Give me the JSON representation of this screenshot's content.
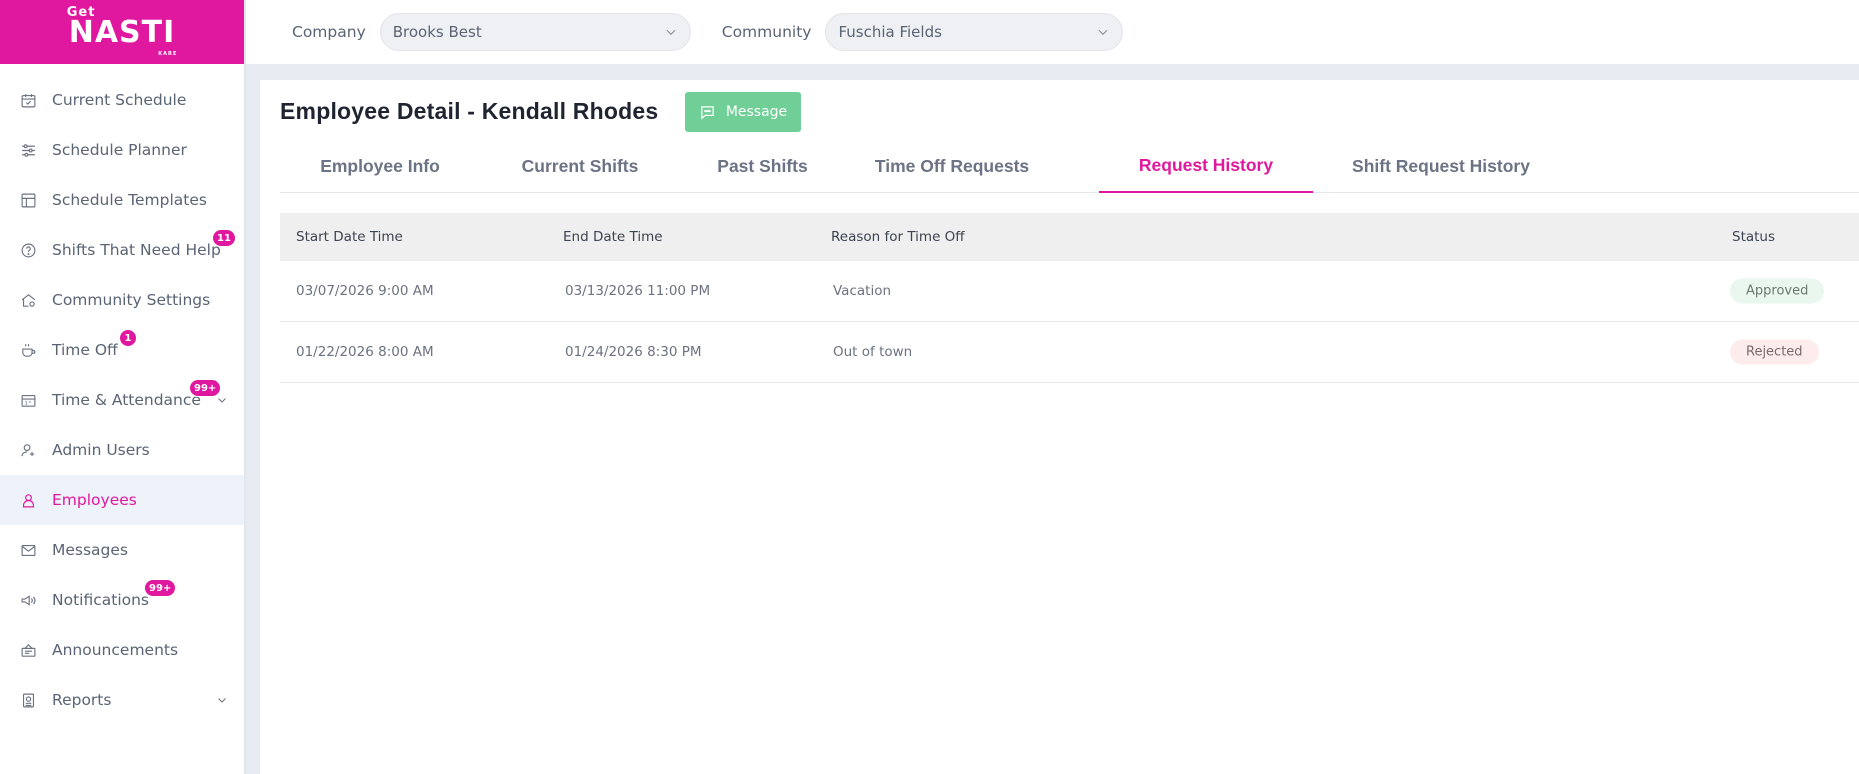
{
  "app": {
    "logo_top": "Get",
    "logo_main": "NASTI",
    "logo_sub": "KARE",
    "brand_color": "#e0189f",
    "success_color": "#6fcf97"
  },
  "sidebar": {
    "items": [
      {
        "label": "Current Schedule",
        "icon": "calendar-check-icon"
      },
      {
        "label": "Schedule Planner",
        "icon": "sliders-icon"
      },
      {
        "label": "Schedule Templates",
        "icon": "layout-icon"
      },
      {
        "label": "Shifts That Need Help",
        "icon": "help-circle-icon",
        "badge": "11"
      },
      {
        "label": "Community Settings",
        "icon": "home-gear-icon"
      },
      {
        "label": "Time Off",
        "icon": "coffee-icon",
        "badge": "1"
      },
      {
        "label": "Time & Attendance",
        "icon": "calendar-grid-icon",
        "badge": "99+"
      },
      {
        "label": "Admin Users",
        "icon": "user-gear-icon"
      },
      {
        "label": "Employees",
        "icon": "user-icon"
      },
      {
        "label": "Messages",
        "icon": "mail-icon"
      },
      {
        "label": "Notifications",
        "icon": "megaphone-icon",
        "badge": "99+"
      },
      {
        "label": "Announcements",
        "icon": "signboard-icon"
      },
      {
        "label": "Reports",
        "icon": "report-icon"
      }
    ]
  },
  "topbar": {
    "company_label": "Company",
    "company_value": "Brooks Best",
    "community_label": "Community",
    "community_value": "Fuschia Fields"
  },
  "main": {
    "title": "Employee Detail - Kendall Rhodes",
    "message_button": "Message",
    "tabs": [
      {
        "label": "Employee Info"
      },
      {
        "label": "Current Shifts"
      },
      {
        "label": "Past Shifts"
      },
      {
        "label": "Time Off Requests"
      },
      {
        "label": "Request History"
      },
      {
        "label": "Shift Request History"
      }
    ],
    "table": {
      "headers": [
        "Start Date Time",
        "End Date Time",
        "Reason for Time Off",
        "Status"
      ],
      "rows": [
        {
          "start": "03/07/2026 9:00 AM",
          "end": "03/13/2026 11:00 PM",
          "reason": "Vacation",
          "status": "Approved"
        },
        {
          "start": "01/22/2026 8:00 AM",
          "end": "01/24/2026 8:30 PM",
          "reason": "Out of town",
          "status": "Rejected"
        }
      ]
    }
  }
}
